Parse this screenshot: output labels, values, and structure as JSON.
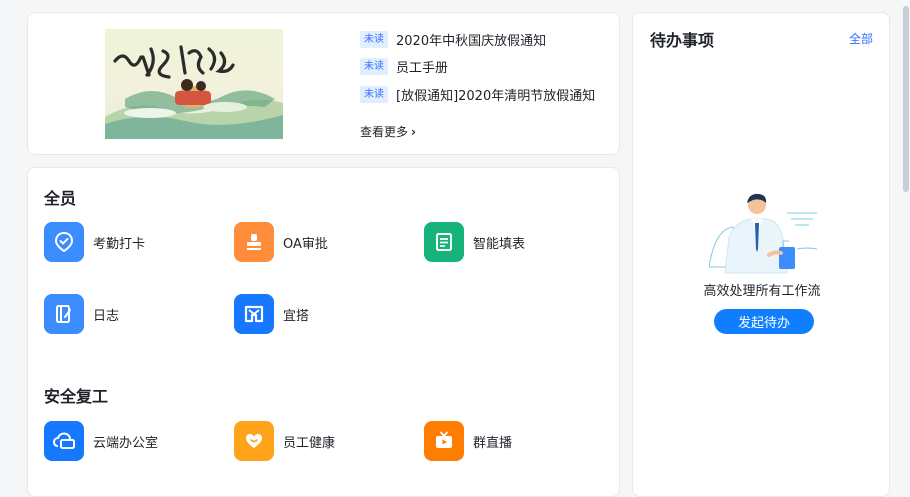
{
  "news": {
    "unread_badge": "未读",
    "items": [
      {
        "title": "2020年中秋国庆放假通知"
      },
      {
        "title": "员工手册"
      },
      {
        "title": "[放假通知]2020年清明节放假通知"
      }
    ],
    "more_label": "查看更多"
  },
  "apps": {
    "sections": [
      {
        "title": "全员",
        "items": [
          {
            "label": "考勤打卡",
            "icon": "checkin-pin-icon",
            "color": "#3b8cff"
          },
          {
            "label": "OA审批",
            "icon": "stamp-icon",
            "color": "#ff8c3b"
          },
          {
            "label": "智能填表",
            "icon": "form-icon",
            "color": "#16b37a"
          },
          {
            "label": "日志",
            "icon": "log-icon",
            "color": "#3b8cff"
          },
          {
            "label": "宜搭",
            "icon": "yida-icon",
            "color": "#1677ff"
          }
        ]
      },
      {
        "title": "安全复工",
        "items": [
          {
            "label": "云端办公室",
            "icon": "cloud-office-icon",
            "color": "#1677ff"
          },
          {
            "label": "员工健康",
            "icon": "health-heart-icon",
            "color": "#ffa31a"
          },
          {
            "label": "群直播",
            "icon": "live-tv-icon",
            "color": "#ff7d00"
          }
        ]
      }
    ]
  },
  "todo": {
    "title": "待办事项",
    "all_label": "全部",
    "empty_text": "高效处理所有工作流",
    "button_label": "发起待办"
  },
  "colors": {
    "accent": "#3370ff",
    "button": "#0f7fff"
  }
}
